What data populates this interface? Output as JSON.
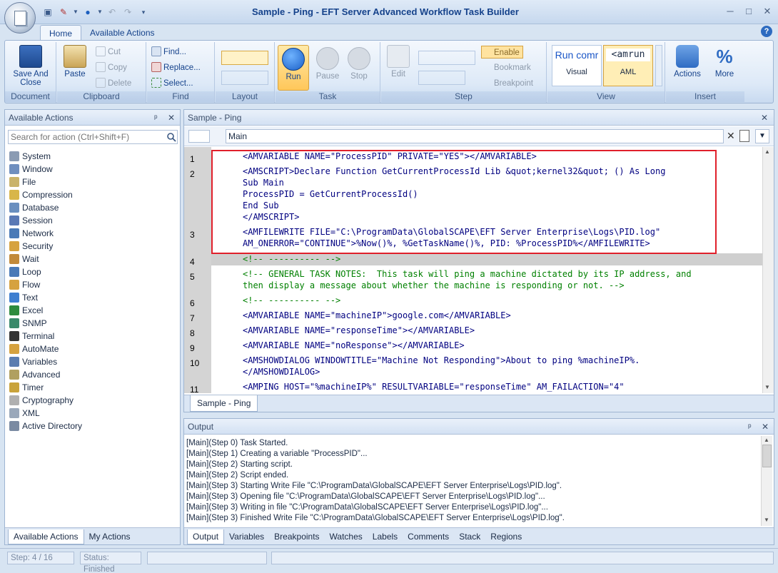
{
  "window": {
    "title": "Sample - Ping - EFT Server Advanced Workflow Task Builder",
    "minimize_glyph": "─",
    "maximize_glyph": "□",
    "close_glyph": "✕"
  },
  "ribbon_tabs": [
    "Home",
    "Available Actions"
  ],
  "help_glyph": "?",
  "ribbon": {
    "document": {
      "label": "Document",
      "save_and_close": "Save And Close"
    },
    "clipboard": {
      "label": "Clipboard",
      "paste": "Paste",
      "cut": "Cut",
      "copy": "Copy",
      "delete": "Delete"
    },
    "find": {
      "label": "Find",
      "find": "Find...",
      "replace": "Replace...",
      "select": "Select..."
    },
    "layout": {
      "label": "Layout"
    },
    "task": {
      "label": "Task",
      "run": "Run",
      "pause": "Pause",
      "stop": "Stop"
    },
    "step": {
      "label": "Step",
      "edit": "Edit",
      "enable": "Enable",
      "bookmark": "Bookmark",
      "breakpoint": "Breakpoint"
    },
    "view": {
      "label": "View",
      "visual_preview": "Run comr",
      "visual": "Visual",
      "aml_preview": "<amrun",
      "aml": "AML"
    },
    "insert": {
      "label": "Insert",
      "actions": "Actions",
      "more": "More"
    }
  },
  "available_actions": {
    "title": "Available Actions",
    "search_placeholder": "Search for action (Ctrl+Shift+F)",
    "items": [
      "System",
      "Window",
      "File",
      "Compression",
      "Database",
      "Session",
      "Network",
      "Security",
      "Wait",
      "Loop",
      "Flow",
      "Text",
      "Excel",
      "SNMP",
      "Terminal",
      "AutoMate",
      "Variables",
      "Advanced",
      "Timer",
      "Cryptography",
      "XML",
      "Active Directory"
    ],
    "tabs": [
      "Available Actions",
      "My Actions"
    ]
  },
  "editor": {
    "title": "Sample - Ping",
    "scope": "Main",
    "tab": "Sample - Ping",
    "line_numbers": [
      "1",
      "2",
      "3",
      "4",
      "5",
      "6",
      "7",
      "8",
      "9",
      "10",
      "11"
    ],
    "lines": [
      "<AMVARIABLE NAME=\"ProcessPID\" PRIVATE=\"YES\"></AMVARIABLE>",
      "<AMSCRIPT>Declare Function GetCurrentProcessId Lib &quot;kernel32&quot; () As Long",
      "Sub Main",
      "ProcessPID = GetCurrentProcessId()",
      "End Sub",
      "</AMSCRIPT>",
      "<AMFILEWRITE FILE=\"C:\\ProgramData\\GlobalSCAPE\\EFT Server Enterprise\\Logs\\PID.log\"",
      "AM_ONERROR=\"CONTINUE\">%Now()%, %GetTaskName()%, PID: %ProcessPID%</AMFILEWRITE>",
      "<!-- ---------- -->",
      "<!-- GENERAL TASK NOTES:  This task will ping a machine dictated by its IP address, and",
      "then display a message about whether the machine is responding or not. -->",
      "<!-- ---------- -->",
      "<AMVARIABLE NAME=\"machineIP\">google.com</AMVARIABLE>",
      "<AMVARIABLE NAME=\"responseTime\"></AMVARIABLE>",
      "<AMVARIABLE NAME=\"noResponse\"></AMVARIABLE>",
      "<AMSHOWDIALOG WINDOWTITLE=\"Machine Not Responding\">About to ping %machineIP%.",
      "</AMSHOWDIALOG>",
      "<AMPING HOST=\"%machineIP%\" RESULTVARIABLE=\"responseTime\" AM_FAILACTION=\"4\""
    ]
  },
  "output": {
    "title": "Output",
    "lines": [
      "[Main](Step 0) Task Started.",
      "[Main](Step 1) Creating a variable \"ProcessPID\"...",
      "[Main](Step 2) Starting script.",
      "[Main](Step 2) Script ended.",
      "[Main](Step 3) Starting Write File \"C:\\ProgramData\\GlobalSCAPE\\EFT Server Enterprise\\Logs\\PID.log\".",
      "[Main](Step 3) Opening file \"C:\\ProgramData\\GlobalSCAPE\\EFT Server Enterprise\\Logs\\PID.log\"...",
      "[Main](Step 3) Writing in file \"C:\\ProgramData\\GlobalSCAPE\\EFT Server Enterprise\\Logs\\PID.log\"...",
      "[Main](Step 3) Finished Write File \"C:\\ProgramData\\GlobalSCAPE\\EFT Server Enterprise\\Logs\\PID.log\"."
    ],
    "tabs": [
      "Output",
      "Variables",
      "Breakpoints",
      "Watches",
      "Labels",
      "Comments",
      "Stack",
      "Regions"
    ]
  },
  "panel_controls": {
    "pin": "ᵖ",
    "close": "✕"
  },
  "status": {
    "step": "Step: 4 / 16",
    "status": "Status: Finished"
  },
  "colors": {
    "accent": "#15428b",
    "highlight_border": "#e0202b",
    "comment": "#008000",
    "code": "#000080"
  }
}
